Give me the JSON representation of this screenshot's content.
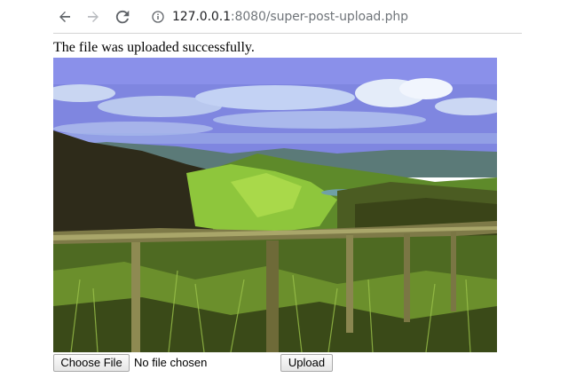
{
  "browser": {
    "url_host": "127.0.0.1",
    "url_rest": ":8080/super-post-upload.php",
    "icons": {
      "back": "arrow-left-icon",
      "forward": "arrow-right-icon",
      "reload": "reload-icon",
      "info": "info-icon"
    }
  },
  "page": {
    "message": "The file was uploaded successfully.",
    "image_description": "uploaded-landscape-photo",
    "form": {
      "choose_file_label": "Choose File",
      "file_status": "No file chosen",
      "upload_label": "Upload"
    }
  },
  "colors": {
    "toolbar_icon": "#5f6368",
    "separator": "#d4d4d4"
  }
}
